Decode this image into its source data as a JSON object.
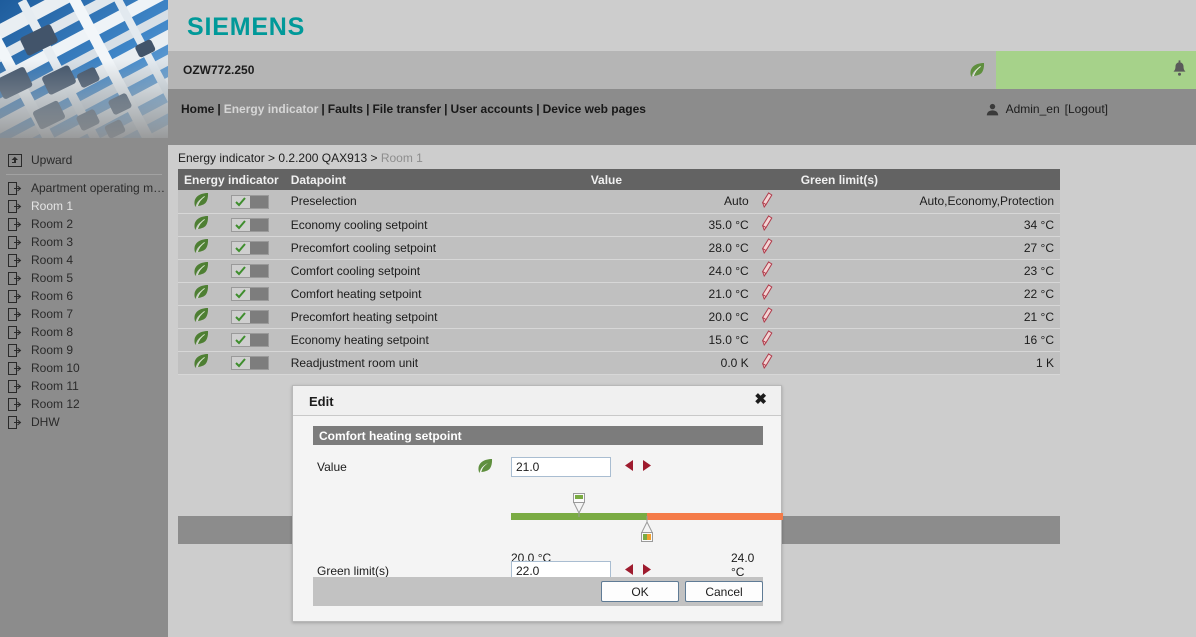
{
  "brand": {
    "name": "SIEMENS",
    "color": "#009999"
  },
  "device": {
    "name": "OZW772.250",
    "leaf_icon": "leaf-icon",
    "alarm_icon": "bell-icon",
    "alarm_bar_color": "#a6d28a"
  },
  "nav": {
    "items": [
      {
        "label": "Home",
        "active": false
      },
      {
        "label": "Energy indicator",
        "active": true
      },
      {
        "label": "Faults",
        "active": false
      },
      {
        "label": "File transfer",
        "active": false
      },
      {
        "label": "User accounts",
        "active": false
      },
      {
        "label": "Device web pages",
        "active": false
      }
    ],
    "separator": "|"
  },
  "user": {
    "icon": "user-icon",
    "name": "Admin_en",
    "logout": "[Logout]"
  },
  "sidebar": {
    "upward": {
      "label": "Upward",
      "icon": "upward-icon"
    },
    "items": [
      {
        "label": "Apartment operating mode",
        "icon": "page-arrow-icon",
        "active": false
      },
      {
        "label": "Room 1",
        "icon": "page-arrow-icon",
        "active": true
      },
      {
        "label": "Room 2",
        "icon": "page-arrow-icon",
        "active": false
      },
      {
        "label": "Room 3",
        "icon": "page-arrow-icon",
        "active": false
      },
      {
        "label": "Room 4",
        "icon": "page-arrow-icon",
        "active": false
      },
      {
        "label": "Room 5",
        "icon": "page-arrow-icon",
        "active": false
      },
      {
        "label": "Room 6",
        "icon": "page-arrow-icon",
        "active": false
      },
      {
        "label": "Room 7",
        "icon": "page-arrow-icon",
        "active": false
      },
      {
        "label": "Room 8",
        "icon": "page-arrow-icon",
        "active": false
      },
      {
        "label": "Room 9",
        "icon": "page-arrow-icon",
        "active": false
      },
      {
        "label": "Room 10",
        "icon": "page-arrow-icon",
        "active": false
      },
      {
        "label": "Room 11",
        "icon": "page-arrow-icon",
        "active": false
      },
      {
        "label": "Room 12",
        "icon": "page-arrow-icon",
        "active": false
      },
      {
        "label": "DHW",
        "icon": "page-arrow-icon",
        "active": false
      }
    ]
  },
  "breadcrumb": {
    "root": "Energy indicator",
    "sep1": " > ",
    "node": "0.2.200 QAX913",
    "sep2": " > ",
    "current": "Room 1"
  },
  "table": {
    "headers": {
      "energy_indicator": "Energy indicator",
      "datapoint": "Datapoint",
      "value": "Value",
      "green_limits": "Green limit(s)"
    },
    "rows": [
      {
        "leaf": "leaf-icon",
        "toggle": true,
        "datapoint": "Preselection",
        "value": "Auto",
        "pencil": "pencil-icon",
        "limit": "Auto,Economy,Protection"
      },
      {
        "leaf": "leaf-icon",
        "toggle": true,
        "datapoint": "Economy cooling setpoint",
        "value": "35.0 °C",
        "pencil": "pencil-icon",
        "limit": "34 °C"
      },
      {
        "leaf": "leaf-icon",
        "toggle": true,
        "datapoint": "Precomfort cooling setpoint",
        "value": "28.0 °C",
        "pencil": "pencil-icon",
        "limit": "27 °C"
      },
      {
        "leaf": "leaf-icon",
        "toggle": true,
        "datapoint": "Comfort cooling setpoint",
        "value": "24.0 °C",
        "pencil": "pencil-icon",
        "limit": "23 °C"
      },
      {
        "leaf": "leaf-icon",
        "toggle": true,
        "datapoint": "Comfort heating setpoint",
        "value": "21.0 °C",
        "pencil": "pencil-icon",
        "limit": "22 °C"
      },
      {
        "leaf": "leaf-icon",
        "toggle": true,
        "datapoint": "Precomfort heating setpoint",
        "value": "20.0 °C",
        "pencil": "pencil-icon",
        "limit": "21 °C"
      },
      {
        "leaf": "leaf-icon",
        "toggle": true,
        "datapoint": "Economy heating setpoint",
        "value": "15.0 °C",
        "pencil": "pencil-icon",
        "limit": "16 °C"
      },
      {
        "leaf": "leaf-icon",
        "toggle": true,
        "datapoint": "Readjustment room unit",
        "value": "0.0 K",
        "pencil": "pencil-icon",
        "limit": "1 K"
      }
    ]
  },
  "dialog": {
    "title": "Edit",
    "close": "✖",
    "section_title": "Comfort heating setpoint",
    "value_label": "Value",
    "value": "21.0",
    "leaf_icon": "leaf-icon",
    "limit_label": "Green limit(s)",
    "limit": "22.0",
    "scale_min": "20.0 °C",
    "scale_max": "24.0 °C",
    "slider": {
      "min": 20.0,
      "max": 24.0,
      "value": 21.0,
      "green_limit": 22.0,
      "green_color": "#7aab43",
      "orange_color": "#f47b48"
    },
    "ok": "OK",
    "cancel": "Cancel",
    "arrow_color": "#9e1b2e"
  }
}
